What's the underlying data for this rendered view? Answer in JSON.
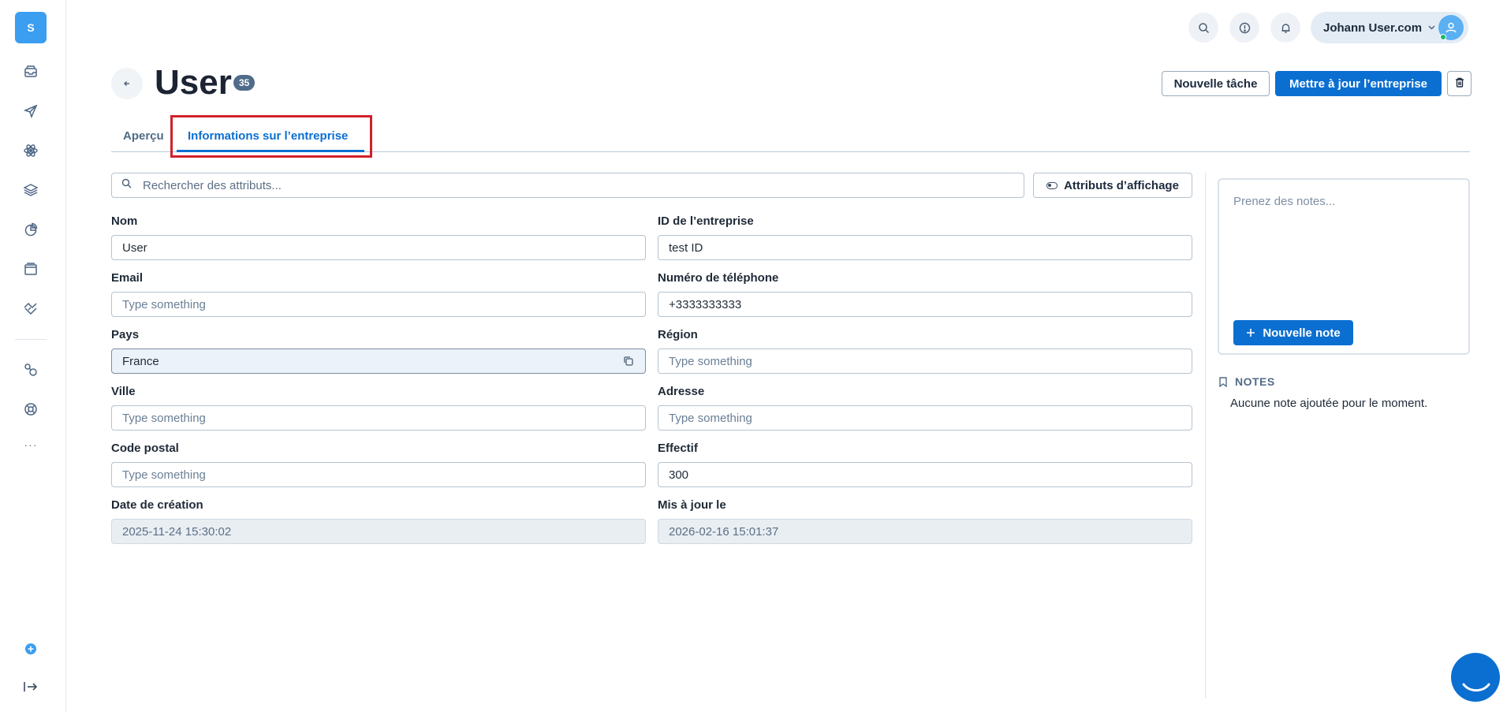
{
  "sidebar": {
    "logo_letter": "S",
    "items": [
      {
        "icon": "inbox-icon"
      },
      {
        "icon": "send-icon"
      },
      {
        "icon": "atom-icon"
      },
      {
        "icon": "layers-icon"
      },
      {
        "icon": "pie-chart-icon"
      },
      {
        "icon": "window-icon"
      },
      {
        "icon": "handshake-icon"
      },
      {
        "icon": "integrations-icon"
      },
      {
        "icon": "support-icon"
      }
    ],
    "more_label": "···",
    "bottom_icons": [
      "add-circle-icon",
      "logout-icon"
    ]
  },
  "topbar": {
    "icons": [
      "search-icon",
      "info-icon",
      "bell-icon"
    ],
    "user_name": "Johann User.com",
    "status_color": "#1fb56c"
  },
  "header": {
    "title": "User",
    "count": "35",
    "new_task_label": "Nouvelle tâche",
    "update_label": "Mettre à jour l’entreprise"
  },
  "tabs": [
    {
      "label": "Aperçu",
      "active": false
    },
    {
      "label": "Informations sur l’entreprise",
      "active": true
    }
  ],
  "search": {
    "placeholder": "Rechercher des attributs...",
    "display_attributes_label": "Attributs d’affichage"
  },
  "fields": {
    "nom": {
      "label": "Nom",
      "value": "User"
    },
    "company_id": {
      "label": "ID de l’entreprise",
      "value": "test ID"
    },
    "email": {
      "label": "Email",
      "value": "Type something"
    },
    "phone": {
      "label": "Numéro de téléphone",
      "value": "+3333333333"
    },
    "pays": {
      "label": "Pays",
      "value": "France"
    },
    "region": {
      "label": "Région",
      "value": "Type something"
    },
    "ville": {
      "label": "Ville",
      "value": "Type something"
    },
    "adresse": {
      "label": "Adresse",
      "value": "Type something"
    },
    "code_postal": {
      "label": "Code postal",
      "value": "Type something"
    },
    "effectif": {
      "label": "Effectif",
      "value": "300"
    },
    "created": {
      "label": "Date de création",
      "value": "2025-11-24 15:30:02"
    },
    "updated": {
      "label": "Mis à jour le",
      "value": "2026-02-16 15:01:37"
    }
  },
  "notes": {
    "placeholder": "Prenez des notes...",
    "new_note_label": "Nouvelle note",
    "section_title": "NOTES",
    "empty_text": "Aucune note ajoutée pour le moment."
  },
  "colors": {
    "accent": "#0b6fd1",
    "logo": "#3b9ef0",
    "highlight": "#d0212a"
  }
}
